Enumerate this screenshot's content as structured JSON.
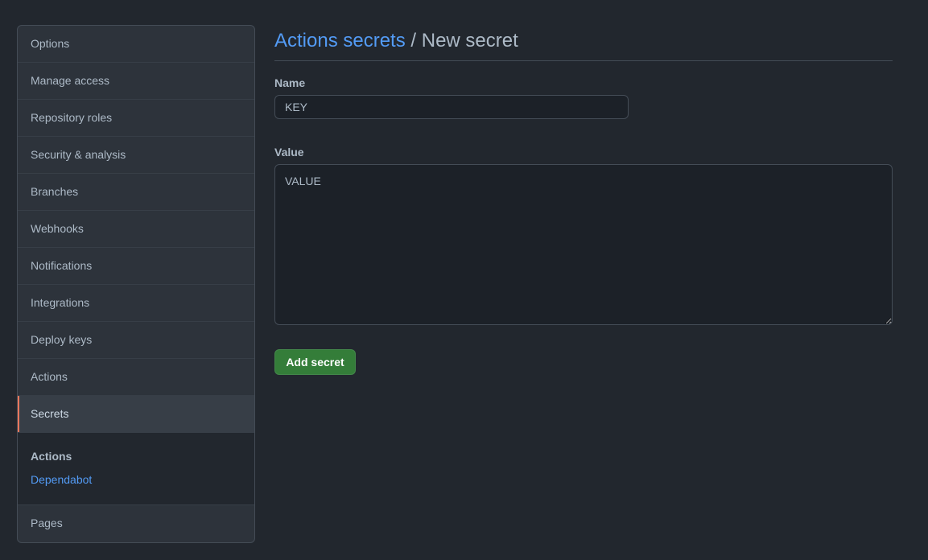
{
  "sidebar": {
    "items": [
      {
        "label": "Options"
      },
      {
        "label": "Manage access"
      },
      {
        "label": "Repository roles"
      },
      {
        "label": "Security & analysis"
      },
      {
        "label": "Branches"
      },
      {
        "label": "Webhooks"
      },
      {
        "label": "Notifications"
      },
      {
        "label": "Integrations"
      },
      {
        "label": "Deploy keys"
      },
      {
        "label": "Actions"
      },
      {
        "label": "Secrets"
      }
    ],
    "selected": "Secrets",
    "subnav": {
      "heading": "Actions",
      "link": "Dependabot"
    },
    "last_item": "Pages"
  },
  "header": {
    "breadcrumb_link": "Actions secrets",
    "separator": " / ",
    "title": "New secret"
  },
  "form": {
    "name_label": "Name",
    "name_value": "KEY",
    "value_label": "Value",
    "value_value": "VALUE",
    "submit_label": "Add secret"
  },
  "colors": {
    "background": "#22272e",
    "accent_link": "#539bf5",
    "selected_marker": "#ec775c",
    "primary_button": "#347d39"
  }
}
